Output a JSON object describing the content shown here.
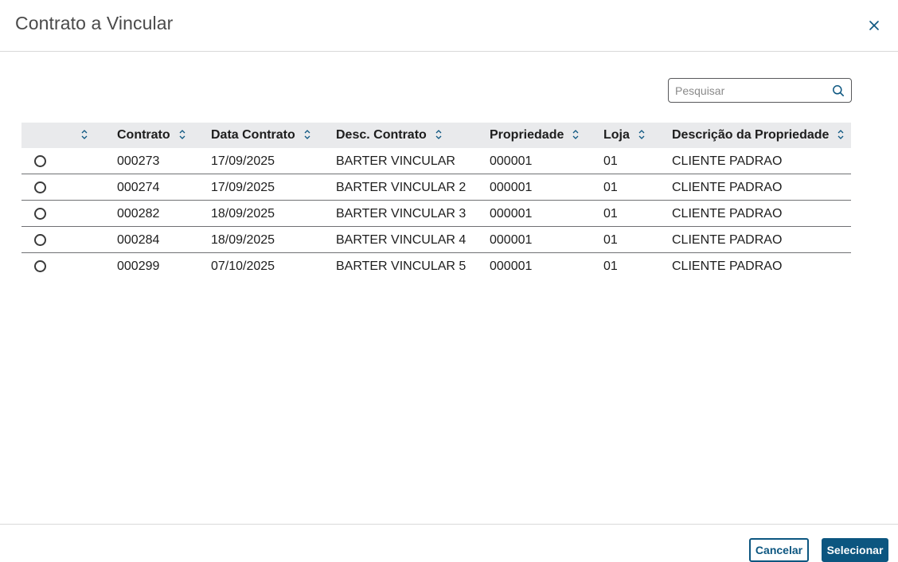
{
  "dialog": {
    "title": "Contrato a Vincular",
    "close_icon": "close-icon"
  },
  "search": {
    "placeholder": "Pesquisar",
    "value": "",
    "icon": "search-icon"
  },
  "table": {
    "columns": [
      {
        "label": "",
        "sort_icon": "sort-icon"
      },
      {
        "label": "Contrato",
        "sort_icon": "sort-icon"
      },
      {
        "label": "Data Contrato",
        "sort_icon": "sort-icon"
      },
      {
        "label": "Desc. Contrato",
        "sort_icon": "sort-icon"
      },
      {
        "label": "Propriedade",
        "sort_icon": "sort-icon"
      },
      {
        "label": "Loja",
        "sort_icon": "sort-icon"
      },
      {
        "label": "Descrição da Propriedade",
        "sort_icon": "sort-icon"
      }
    ],
    "rows": [
      {
        "contrato": "000273",
        "data": "17/09/2025",
        "desc": "BARTER VINCULAR",
        "propriedade": "000001",
        "loja": "01",
        "descricao": "CLIENTE PADRAO",
        "selected": false
      },
      {
        "contrato": "000274",
        "data": "17/09/2025",
        "desc": "BARTER VINCULAR 2",
        "propriedade": "000001",
        "loja": "01",
        "descricao": "CLIENTE PADRAO",
        "selected": false
      },
      {
        "contrato": "000282",
        "data": "18/09/2025",
        "desc": "BARTER VINCULAR 3",
        "propriedade": "000001",
        "loja": "01",
        "descricao": "CLIENTE PADRAO",
        "selected": false
      },
      {
        "contrato": "000284",
        "data": "18/09/2025",
        "desc": "BARTER VINCULAR 4",
        "propriedade": "000001",
        "loja": "01",
        "descricao": "CLIENTE PADRAO",
        "selected": false
      },
      {
        "contrato": "000299",
        "data": "07/10/2025",
        "desc": "BARTER VINCULAR 5",
        "propriedade": "000001",
        "loja": "01",
        "descricao": "CLIENTE PADRAO",
        "selected": false
      }
    ]
  },
  "footer": {
    "cancel_label": "Cancelar",
    "select_label": "Selecionar"
  },
  "colors": {
    "primary": "#0c5680",
    "header_bg": "#e9eaec",
    "title_text": "#4a4a4a"
  }
}
